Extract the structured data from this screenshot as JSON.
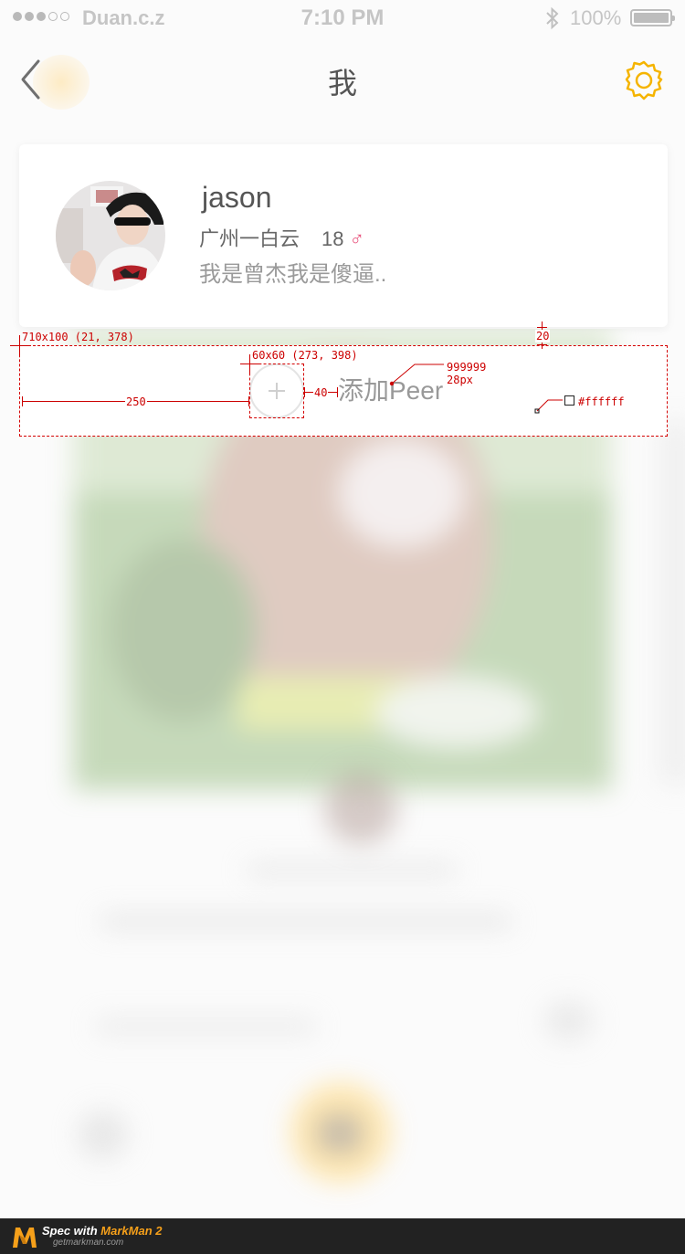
{
  "status_bar": {
    "carrier": "Duan.c.z",
    "time": "7:10 PM",
    "battery": "100%"
  },
  "nav": {
    "title": "我"
  },
  "profile": {
    "name": "jason",
    "location": "广州一白云",
    "age": "18",
    "gender_symbol": "♂",
    "bio": "我是曾杰我是傻逼.."
  },
  "add_peer": {
    "label": "添加Peer"
  },
  "spec": {
    "row_dims": "710x100 (21, 378)",
    "icon_dims": "60x60 (273, 398)",
    "left_gap": "250",
    "icon_gap": "40",
    "top_gap": "20",
    "text_color": "999999",
    "text_size": "28px",
    "bg_color": "#ffffff"
  },
  "footer": {
    "spec_prefix": "Spec with ",
    "brand": "MarkMan 2",
    "site": "getmarkman.com"
  },
  "colors": {
    "accent": "#f5b400",
    "gender": "#e8527c",
    "spec_red": "#cc0000",
    "placeholder": "#999999"
  }
}
